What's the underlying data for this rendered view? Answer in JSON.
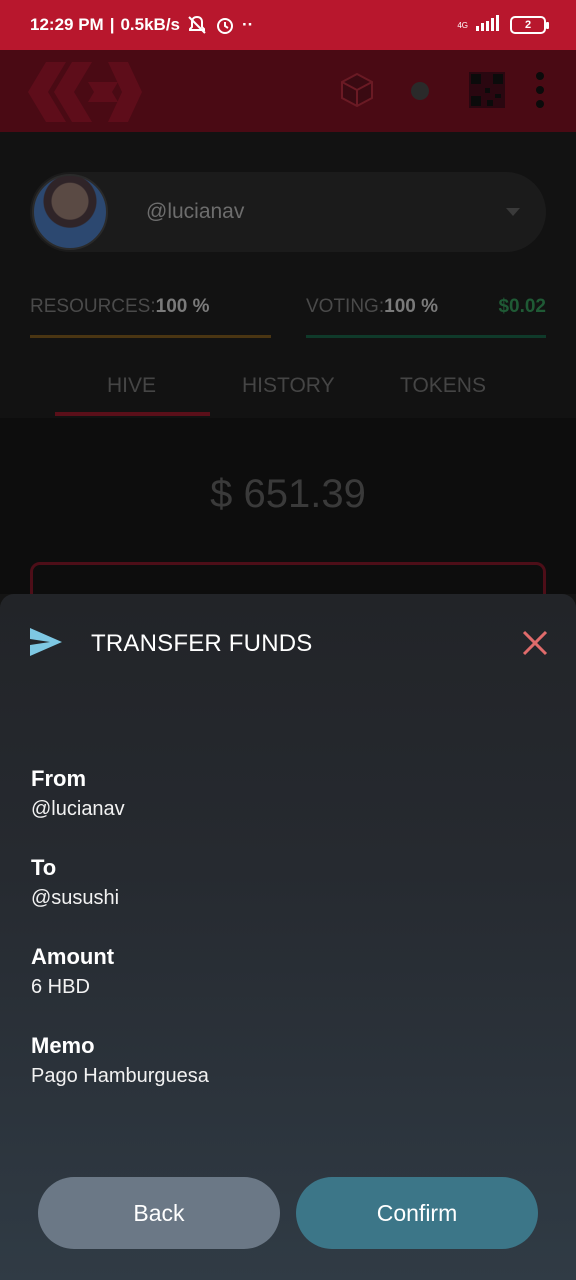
{
  "status_bar": {
    "time": "12:29 PM",
    "separator": "|",
    "speed": "0.5kB/s",
    "dots": "··",
    "network": "4G",
    "battery": "2"
  },
  "account": {
    "username": "@lucianav"
  },
  "resources": {
    "resources_label": "RESOURCES:",
    "resources_value": "100 %",
    "voting_label": "VOTING:",
    "voting_value": "100 %",
    "vote_value": "$0.02"
  },
  "tabs": [
    {
      "label": "HIVE"
    },
    {
      "label": "HISTORY"
    },
    {
      "label": "TOKENS"
    }
  ],
  "wallet": {
    "balance": "$ 651.39"
  },
  "transfer": {
    "title": "TRANSFER FUNDS",
    "fields": [
      {
        "label": "From",
        "value": "@lucianav"
      },
      {
        "label": "To",
        "value": "@susushi"
      },
      {
        "label": "Amount",
        "value": "6 HBD"
      },
      {
        "label": "Memo",
        "value": "Pago Hamburguesa"
      }
    ],
    "back_label": "Back",
    "confirm_label": "Confirm"
  },
  "colors": {
    "status_bar": "#b8172d",
    "confirm_button": "#3c7688",
    "back_button": "#6b7886",
    "close_icon": "#e06b6b",
    "send_icon": "#7ec8e3"
  }
}
